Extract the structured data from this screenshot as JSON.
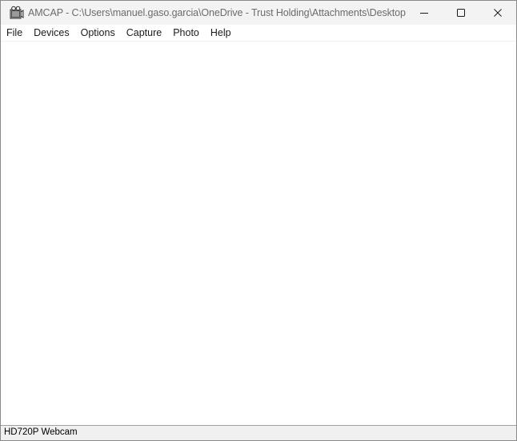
{
  "window": {
    "title": "AMCAP - C:\\Users\\manuel.gaso.garcia\\OneDrive - Trust Holding\\Attachments\\Desktop",
    "app_icon": "camera-app-icon",
    "caption_buttons": {
      "minimize_icon": "minimize-icon",
      "maximize_icon": "maximize-icon",
      "close_icon": "close-icon"
    }
  },
  "menubar": {
    "items": [
      {
        "label": "File"
      },
      {
        "label": "Devices"
      },
      {
        "label": "Options"
      },
      {
        "label": "Capture"
      },
      {
        "label": "Photo"
      },
      {
        "label": "Help"
      }
    ]
  },
  "statusbar": {
    "text": "HD720P Webcam"
  },
  "colors": {
    "titlebar_bg": "#f3f3f3",
    "client_bg": "#ffffff",
    "statusbar_bg": "#f0f0f0"
  }
}
